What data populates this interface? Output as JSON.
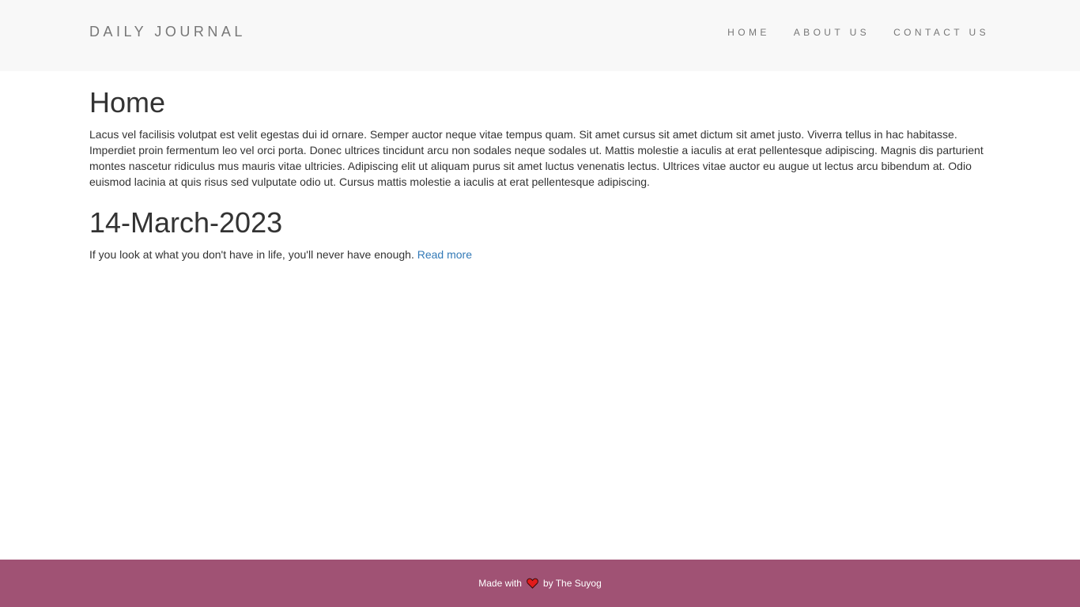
{
  "navbar": {
    "brand": "DAILY JOURNAL",
    "links": [
      {
        "label": "HOME"
      },
      {
        "label": "ABOUT US"
      },
      {
        "label": "CONTACT US"
      }
    ]
  },
  "home": {
    "title": "Home",
    "body": "Lacus vel facilisis volutpat est velit egestas dui id ornare. Semper auctor neque vitae tempus quam. Sit amet cursus sit amet dictum sit amet justo. Viverra tellus in hac habitasse. Imperdiet proin fermentum leo vel orci porta. Donec ultrices tincidunt arcu non sodales neque sodales ut. Mattis molestie a iaculis at erat pellentesque adipiscing. Magnis dis parturient montes nascetur ridiculus mus mauris vitae ultricies. Adipiscing elit ut aliquam purus sit amet luctus venenatis lectus. Ultrices vitae auctor eu augue ut lectus arcu bibendum at. Odio euismod lacinia at quis risus sed vulputate odio ut. Cursus mattis molestie a iaculis at erat pellentesque adipiscing."
  },
  "posts": [
    {
      "title": "14-March-2023",
      "excerpt": "If you look at what you don't have in life, you'll never have enough.",
      "read_more": "Read more"
    }
  ],
  "footer": {
    "prefix": "Made with",
    "icon": "heart-icon",
    "suffix": "by The Suyog"
  },
  "colors": {
    "navbar_bg": "#f8f8f8",
    "footer_bg": "#a05274",
    "link": "#337ab7",
    "heart": "#e21b1b"
  }
}
